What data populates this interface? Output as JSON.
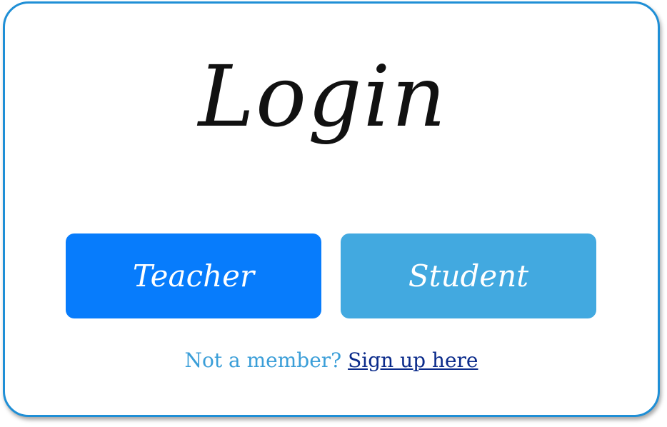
{
  "login": {
    "title": "Login",
    "teacher_button_label": "Teacher",
    "student_button_label": "Student",
    "signup_prompt": "Not a member?",
    "signup_link_label": "Sign up here"
  },
  "colors": {
    "card_border": "#1f8fd6",
    "teacher_button": "#077cfc",
    "student_button": "#42a9e0",
    "signup_prompt": "#3a9ed8",
    "signup_link": "#0a2a8a"
  }
}
